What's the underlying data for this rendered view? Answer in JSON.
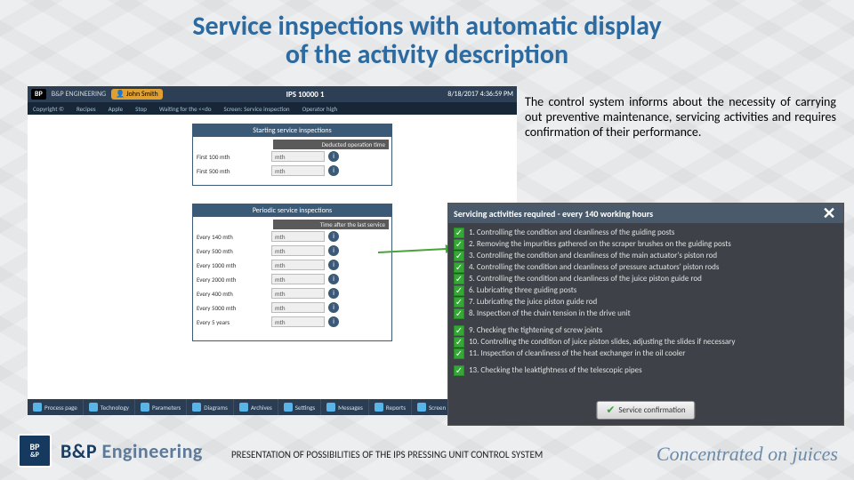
{
  "title_line1": "Service inspections with automatic display",
  "title_line2": "of the activity description",
  "description": "The control system informs about the necessity of carrying out preventive maintenance, servicing activities and requires confirmation of their performance.",
  "app": {
    "brand_short": "BP",
    "brand_name": "B&P ENGINEERING",
    "user": "John Smith",
    "center_title": "IPS 10000 1",
    "timestamp": "8/18/2017 4:36:59 PM",
    "menubar": [
      "Copyright ©",
      "Recipes",
      "Apple",
      "Stop",
      "Waiting for the <<do",
      "Screen: Service inspection",
      "Operator high"
    ],
    "panel_starting": {
      "header": "Starting service inspections",
      "subheader": "Deducted operation time",
      "rows": [
        {
          "label": "First 100 mth",
          "value": "mth"
        },
        {
          "label": "First 500 mth",
          "value": "mth"
        }
      ]
    },
    "panel_periodic": {
      "header": "Periodic service inspections",
      "subheader": "Time after the last service",
      "rows": [
        {
          "label": "Every 140 mth",
          "value": "mth"
        },
        {
          "label": "Every 500 mth",
          "value": "mth"
        },
        {
          "label": "Every 1000 mth",
          "value": "mth"
        },
        {
          "label": "Every 2000 mth",
          "value": "mth"
        },
        {
          "label": "Every 400 mth",
          "value": "mth"
        },
        {
          "label": "Every 5000 mth",
          "value": "mth"
        },
        {
          "label": "Every 5 years",
          "value": "mth"
        }
      ]
    },
    "taskbar": [
      "Process page",
      "Technology",
      "Parameters",
      "Diagrams",
      "Archives",
      "Settings",
      "Messages",
      "Reports",
      "Screen saver"
    ]
  },
  "popup": {
    "title": "Servicing activities required - every 140 working hours",
    "items": [
      "1. Controlling the condition and cleanliness of the guiding posts",
      "2. Removing the impurities gathered on the scraper brushes on the guiding posts",
      "3. Controlling the condition and cleanliness of the main actuator's piston rod",
      "4. Controlling the condition and cleanliness of pressure actuators' piston rods",
      "5. Controlling the condition and cleanliness of the juice piston guide rod",
      "6. Lubricating three guiding posts",
      "7. Lubricating the juice piston guide rod",
      "8. Inspection of the chain tension in the drive unit",
      "9. Checking the tightening of screw joints",
      "10. Controlling the condition of juice piston slides, adjusting the slides if necessary",
      "11. Inspection of cleanliness of the heat exchanger in the oil cooler",
      "13. Checking the leaktightness of the telescopic pipes"
    ],
    "confirm_label": "Service confirmation"
  },
  "footer": {
    "logo_short": "BP&P",
    "brand_html_1": "B&P ",
    "brand_html_2": "Engineering",
    "caption": "PRESENTATION OF POSSIBILITIES OF THE IPS PRESSING UNIT CONTROL SYSTEM",
    "slogan": "Concentrated on juices"
  }
}
